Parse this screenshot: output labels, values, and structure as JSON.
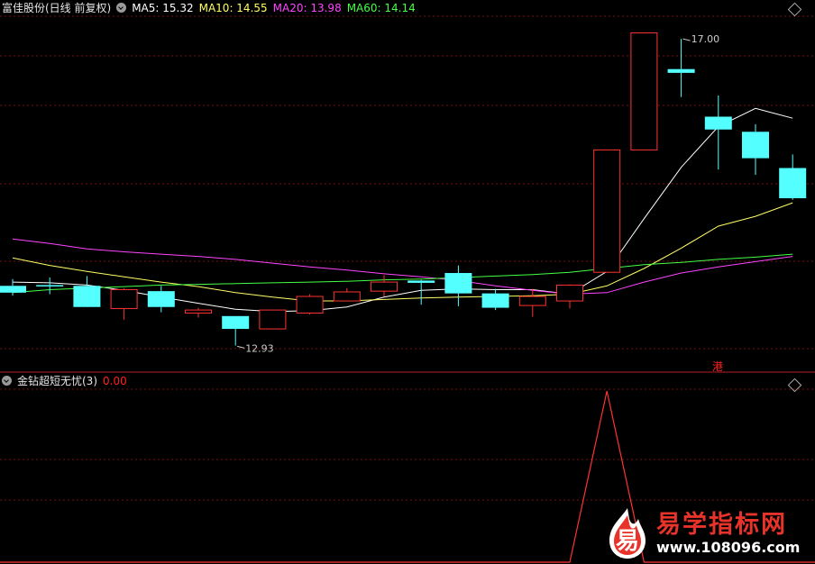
{
  "header": {
    "stock_title": "富佳股份(日线 前复权)",
    "ma": [
      {
        "label": "MA5: 15.32",
        "color": "#ffffff"
      },
      {
        "label": "MA10: 14.55",
        "color": "#ffff66"
      },
      {
        "label": "MA20: 13.98",
        "color": "#ff44ff"
      },
      {
        "label": "MA60: 14.14",
        "color": "#44ff44"
      }
    ]
  },
  "indicator": {
    "name": "金钻超短无忧(3)",
    "value": "0.00",
    "color": "#ff2020"
  },
  "hk_badge": "港",
  "watermark": {
    "logo_char": "易",
    "title": "易学指标网",
    "url": "www.108096.com"
  },
  "colors": {
    "up": "#ff3232",
    "down": "#54ffff",
    "ma5": "#ffffff",
    "ma10": "#ffff66",
    "ma20": "#ff44ff",
    "ma60": "#44ff44",
    "grid": "#7a1010",
    "separator": "#b02020"
  },
  "chart_data": [
    {
      "type": "candlestick",
      "title": "富佳股份(日线 前复权)",
      "y_range": [
        12.6,
        17.3
      ],
      "annotations": [
        {
          "text": "17.00",
          "value": 17.0,
          "index": 18,
          "kind": "high"
        },
        {
          "text": "12.93",
          "value": 12.93,
          "index": 6,
          "kind": "low"
        }
      ],
      "candles": [
        {
          "o": 13.73,
          "h": 13.82,
          "l": 13.6,
          "c": 13.64
        },
        {
          "o": 13.74,
          "h": 13.84,
          "l": 13.62,
          "c": 13.73
        },
        {
          "o": 13.73,
          "h": 13.86,
          "l": 13.48,
          "c": 13.45
        },
        {
          "o": 13.43,
          "h": 13.7,
          "l": 13.28,
          "c": 13.68
        },
        {
          "o": 13.66,
          "h": 13.73,
          "l": 13.38,
          "c": 13.45
        },
        {
          "o": 13.37,
          "h": 13.44,
          "l": 13.31,
          "c": 13.41
        },
        {
          "o": 13.33,
          "h": 13.33,
          "l": 12.94,
          "c": 13.16
        },
        {
          "o": 13.16,
          "h": 13.41,
          "l": 13.16,
          "c": 13.41
        },
        {
          "o": 13.37,
          "h": 13.62,
          "l": 13.35,
          "c": 13.59
        },
        {
          "o": 13.53,
          "h": 13.7,
          "l": 13.53,
          "c": 13.65
        },
        {
          "o": 13.66,
          "h": 13.87,
          "l": 13.59,
          "c": 13.78
        },
        {
          "o": 13.8,
          "h": 13.81,
          "l": 13.48,
          "c": 13.77
        },
        {
          "o": 13.9,
          "h": 14.0,
          "l": 13.46,
          "c": 13.63
        },
        {
          "o": 13.63,
          "h": 13.69,
          "l": 13.41,
          "c": 13.44
        },
        {
          "o": 13.47,
          "h": 13.69,
          "l": 13.32,
          "c": 13.59
        },
        {
          "o": 13.53,
          "h": 13.75,
          "l": 13.43,
          "c": 13.74
        },
        {
          "o": 13.91,
          "h": 15.53,
          "l": 13.91,
          "c": 15.53
        },
        {
          "o": 15.53,
          "h": 17.08,
          "l": 15.53,
          "c": 17.08
        },
        {
          "o": 16.6,
          "h": 17.0,
          "l": 16.23,
          "c": 16.55
        },
        {
          "o": 15.97,
          "h": 16.25,
          "l": 15.27,
          "c": 15.8
        },
        {
          "o": 15.77,
          "h": 15.87,
          "l": 15.2,
          "c": 15.42
        },
        {
          "o": 15.29,
          "h": 15.47,
          "l": 14.87,
          "c": 14.89
        }
      ],
      "series": [
        {
          "name": "MA5",
          "values": [
            13.78,
            13.77,
            13.74,
            13.67,
            13.58,
            13.5,
            13.42,
            13.39,
            13.4,
            13.45,
            13.58,
            13.67,
            13.69,
            13.68,
            13.68,
            13.62,
            13.92,
            14.62,
            15.3,
            15.84,
            16.08,
            15.95
          ]
        },
        {
          "name": "MA10",
          "values": [
            14.1,
            14.0,
            13.92,
            13.85,
            13.78,
            13.72,
            13.64,
            13.58,
            13.53,
            13.53,
            13.55,
            13.57,
            13.58,
            13.59,
            13.6,
            13.62,
            13.73,
            13.96,
            14.23,
            14.52,
            14.65,
            14.83
          ]
        },
        {
          "name": "MA20",
          "values": [
            14.35,
            14.29,
            14.22,
            14.18,
            14.15,
            14.12,
            14.08,
            14.03,
            13.98,
            13.94,
            13.89,
            13.85,
            13.8,
            13.73,
            13.67,
            13.62,
            13.64,
            13.78,
            13.9,
            13.98,
            14.05,
            14.12
          ]
        },
        {
          "name": "MA60",
          "values": [
            13.64,
            13.68,
            13.7,
            13.72,
            13.74,
            13.75,
            13.76,
            13.77,
            13.78,
            13.79,
            13.81,
            13.82,
            13.84,
            13.86,
            13.88,
            13.91,
            13.96,
            14.01,
            14.04,
            14.08,
            14.11,
            14.15
          ]
        }
      ]
    },
    {
      "type": "line",
      "title": "金钻超短无忧(3)",
      "y_range": [
        0,
        1.0
      ],
      "series": [
        {
          "name": "金钻超短无忧(3)",
          "values": [
            0,
            0,
            0,
            0,
            0,
            0,
            0,
            0,
            0,
            0,
            0,
            0,
            0,
            0,
            0,
            0,
            1,
            0,
            0,
            0,
            0,
            0
          ]
        }
      ]
    }
  ]
}
